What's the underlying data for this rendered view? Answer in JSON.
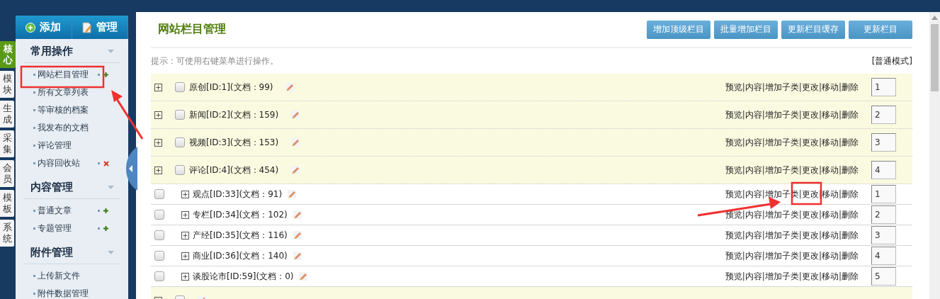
{
  "vertical_tabs": [
    {
      "label": "核心",
      "selected": true
    },
    {
      "label": "模块",
      "selected": false
    },
    {
      "label": "生成",
      "selected": false
    },
    {
      "label": "采集",
      "selected": false
    },
    {
      "label": "会员",
      "selected": false
    },
    {
      "label": "模板",
      "selected": false
    },
    {
      "label": "系统",
      "selected": false
    }
  ],
  "sidebar": {
    "buttons": [
      {
        "label": "添加",
        "kind": "add"
      },
      {
        "label": "管理",
        "kind": "manage"
      }
    ],
    "sections": [
      {
        "title": "常用操作",
        "items": [
          {
            "label": "网站栏目管理",
            "kind": "add"
          },
          {
            "label": "所有文章列表",
            "kind": "plain"
          },
          {
            "label": "等审核的档案",
            "kind": "plain"
          },
          {
            "label": "我发布的文档",
            "kind": "plain"
          },
          {
            "label": "评论管理",
            "kind": "plain"
          },
          {
            "label": "内容回收站",
            "kind": "delete"
          }
        ]
      },
      {
        "title": "内容管理",
        "items": [
          {
            "label": "普通文章",
            "kind": "add"
          },
          {
            "label": "专题管理",
            "kind": "add"
          }
        ]
      },
      {
        "title": "附件管理",
        "items": [
          {
            "label": "上传新文件",
            "kind": "plain"
          },
          {
            "label": "附件数据管理",
            "kind": "plain"
          }
        ]
      }
    ]
  },
  "page": {
    "title": "网站栏目管理",
    "buttons": [
      "增加顶级栏目",
      "批量增加栏目",
      "更新栏目缓存",
      "更新栏目"
    ],
    "hint": "提示：可使用右键菜单进行操作。",
    "mode": "[普通模式]"
  },
  "categories": {
    "separator": "|",
    "rows": [
      {
        "name": "原创[ID:1](文档：99)",
        "actions": [
          "预览",
          "内容",
          "增加子类",
          "更改",
          "移动",
          "删除"
        ],
        "order": "1",
        "checked": false
      },
      {
        "name": "新闻[ID:2](文档：159)",
        "actions": [
          "预览",
          "内容",
          "增加子类",
          "更改",
          "移动",
          "删除"
        ],
        "order": "2",
        "checked": false
      },
      {
        "name": "视频[ID:3](文档：153)",
        "actions": [
          "预览",
          "内容",
          "增加子类",
          "更改",
          "移动",
          "删除"
        ],
        "order": "3",
        "checked": false
      },
      {
        "name": "评论[ID:4](文档：454)",
        "actions": [
          "预览",
          "内容",
          "增加子类",
          "更改",
          "移动",
          "删除"
        ],
        "order": "4",
        "checked": false,
        "children": [
          {
            "name": "观点[ID:33](文档：91)",
            "actions": [
              "预览",
              "内容",
              "增加子类",
              "更改",
              "移动",
              "删除"
            ],
            "order": "1",
            "checked": false
          },
          {
            "name": "专栏[ID:34](文档：102)",
            "actions": [
              "预览",
              "内容",
              "增加子类",
              "更改",
              "移动",
              "删除"
            ],
            "order": "2",
            "checked": false
          },
          {
            "name": "产经[ID:35](文档：116)",
            "actions": [
              "预览",
              "内容",
              "增加子类",
              "更改",
              "移动",
              "删除"
            ],
            "order": "3",
            "checked": false
          },
          {
            "name": "商业[ID:36](文档：140)",
            "actions": [
              "预览",
              "内容",
              "增加子类",
              "更改",
              "移动",
              "删除"
            ],
            "order": "4",
            "checked": false
          },
          {
            "name": "谈股论市[ID:59](文档：0)",
            "actions": [
              "预览",
              "内容",
              "增加子类",
              "更改",
              "移动",
              "删除"
            ],
            "order": "5",
            "checked": false
          }
        ]
      },
      {
        "checked": false
      }
    ]
  }
}
